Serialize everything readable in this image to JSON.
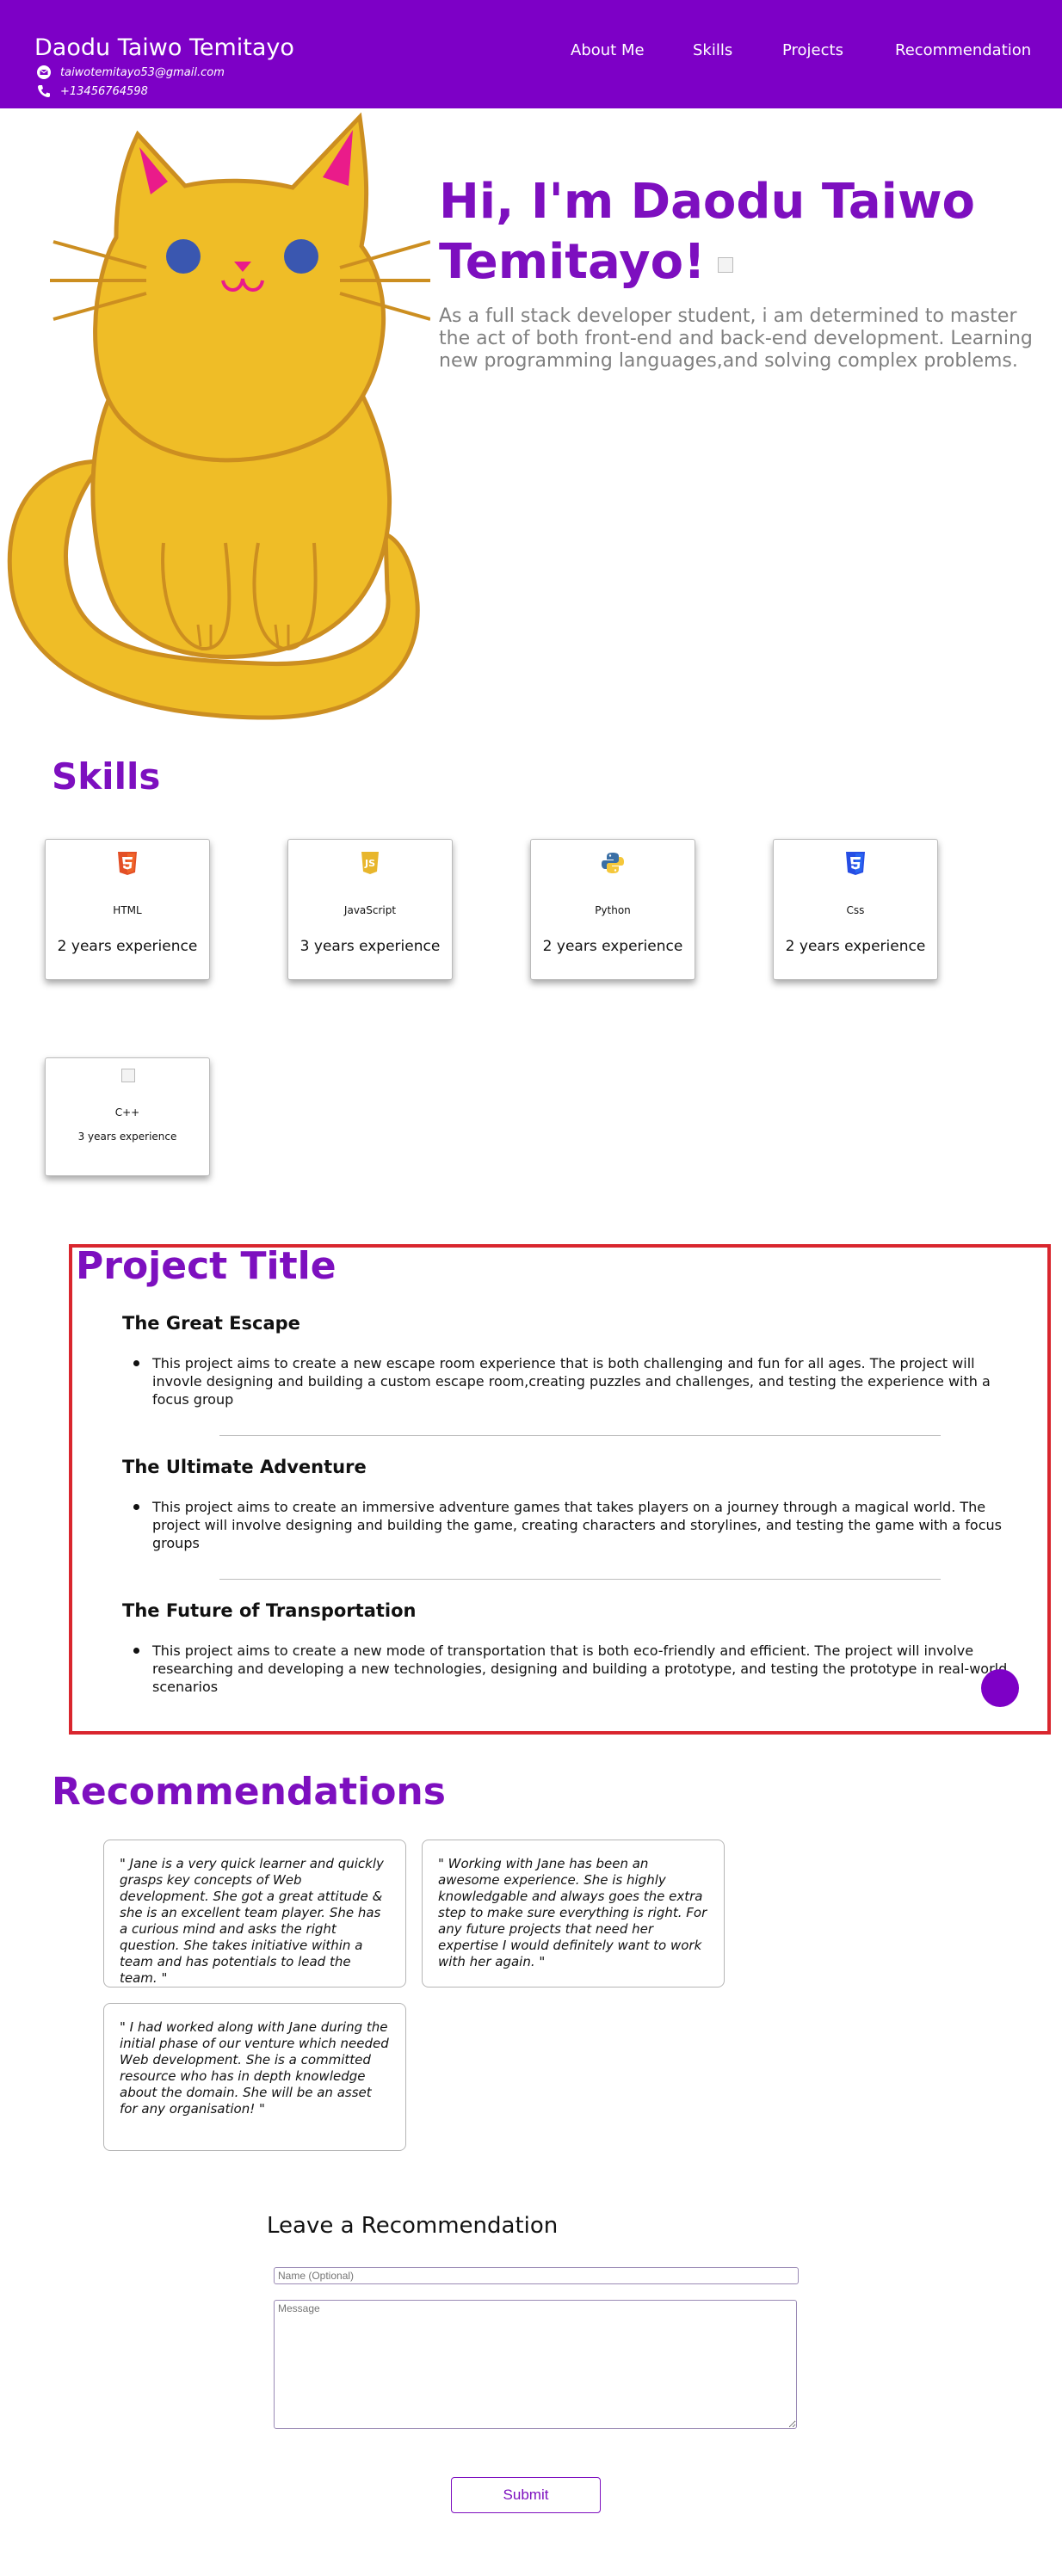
{
  "header": {
    "name": "Daodu Taiwo Temitayo",
    "email": "taiwotemitayo53@gmail.com",
    "phone": "+13456764598",
    "nav": [
      "About Me",
      "Skills",
      "Projects",
      "Recommendation"
    ],
    "bg_color": "#7d00c6"
  },
  "hero": {
    "title": "Hi, I'm Daodu Taiwo Temitayo!",
    "description": "As a full stack developer student, i am determined to master the act of both front-end and back-end development. Learning new programming languages,and solving complex problems.",
    "image_icon": "cat-illustration"
  },
  "skills": {
    "heading": "Skills",
    "items": [
      {
        "name": "HTML",
        "experience": "2 years experience",
        "icon": "html5-icon"
      },
      {
        "name": "JavaScript",
        "experience": "3 years experience",
        "icon": "javascript-icon"
      },
      {
        "name": "Python",
        "experience": "2 years experience",
        "icon": "python-icon"
      },
      {
        "name": "Css",
        "experience": "2 years experience",
        "icon": "css3-icon"
      },
      {
        "name": "C++",
        "experience": "3 years experience",
        "icon": "broken-image-icon"
      }
    ]
  },
  "projects": {
    "heading": "Project Title",
    "items": [
      {
        "title": "The Great Escape",
        "description": "This project aims to create a new escape room experience that is both challenging and fun for all ages. The project will invovle designing and building a custom escape room,creating puzzles and challenges, and testing the experience with a focus group"
      },
      {
        "title": "The Ultimate Adventure",
        "description": "This project aims to create an immersive adventure games that takes players on a journey through a magical world. The project will involve designing and building the game, creating characters and storylines, and testing the game with a focus groups"
      },
      {
        "title": "The Future of Transportation",
        "description": "This project aims to create a new mode of transportation that is both eco-friendly and efficient. The project will involve researching and developing a new technologies, designing and building a prototype, and testing the prototype in real-world scenarios"
      }
    ]
  },
  "recommendations": {
    "heading": "Recommendations",
    "items": [
      "\" Jane is a very quick learner and quickly grasps key concepts of Web development. She got a great attitude & she is an excellent team player. She has a curious mind and asks the right question. She takes initiative within a team and has potentials to lead the team. \"",
      "\" Working with Jane has been an awesome experience. She is highly knowledgable and always goes the extra step to make sure everything is right. For any future projects that need her expertise I would definitely want to work with her again. \"",
      "\" I had worked along with Jane during the initial phase of our venture which needed Web development. She is a committed resource who has in depth knowledge about the domain. She will be an asset for any organisation! \""
    ]
  },
  "form": {
    "heading": "Leave a Recommendation",
    "name_placeholder": "Name (Optional)",
    "message_placeholder": "Message",
    "submit_label": "Submit"
  },
  "colors": {
    "accent": "#7d0fbf",
    "project_border": "#d9262e"
  }
}
